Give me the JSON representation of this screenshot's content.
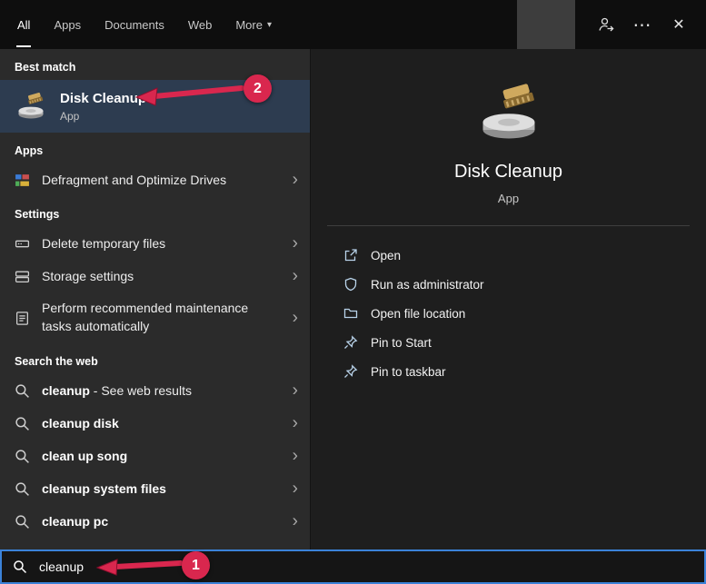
{
  "titlebar": {
    "tabs": [
      {
        "label": "All"
      },
      {
        "label": "Apps"
      },
      {
        "label": "Documents"
      },
      {
        "label": "Web"
      },
      {
        "label": "More"
      }
    ]
  },
  "icons": {
    "chevron": "›",
    "more_caret": "▾",
    "ellipsis": "⋯",
    "close": "✕"
  },
  "left": {
    "best_match_header": "Best match",
    "best_match": {
      "title": "Disk Cleanup",
      "subtitle": "App"
    },
    "apps_header": "Apps",
    "apps": [
      {
        "label": "Defragment and Optimize Drives"
      }
    ],
    "settings_header": "Settings",
    "settings": [
      {
        "label": "Delete temporary files"
      },
      {
        "label": "Storage settings"
      },
      {
        "label": "Perform recommended maintenance tasks automatically"
      }
    ],
    "web_header": "Search the web",
    "web": [
      {
        "query": "cleanup",
        "suffix": " - See web results"
      },
      {
        "query": "cleanup disk",
        "suffix": ""
      },
      {
        "query": "clean up song",
        "suffix": ""
      },
      {
        "query": "cleanup system files",
        "suffix": ""
      },
      {
        "query": "cleanup pc",
        "suffix": ""
      }
    ]
  },
  "right": {
    "title": "Disk Cleanup",
    "subtitle": "App",
    "actions": [
      {
        "label": "Open"
      },
      {
        "label": "Run as administrator"
      },
      {
        "label": "Open file location"
      },
      {
        "label": "Pin to Start"
      },
      {
        "label": "Pin to taskbar"
      }
    ]
  },
  "search": {
    "value": "cleanup"
  },
  "annotations": {
    "step1": "1",
    "step2": "2"
  },
  "colors": {
    "accent_border": "#3b82d8",
    "annotation_red": "#d9274e",
    "best_match_bg": "#2d3c50"
  }
}
